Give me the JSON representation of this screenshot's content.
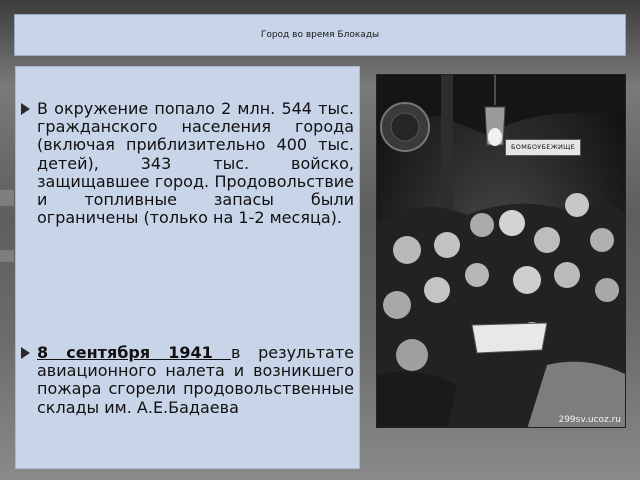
{
  "slide": {
    "title": "Город  во время Блокады",
    "bullets": [
      {
        "text": "В окружение попало 2 млн. 544 тыс. гражданского населения города (включая приблизительно 400 тыс. детей), 343 тыс. войско, защищавшее город. Продовольствие и топливные запасы были ограничены (только на 1-2 месяца)."
      },
      {
        "date": "8 сентября 1941 ",
        "text": "в результате авиационного налета и возникшего пожара сгорели продовольственные склады им. А.Е.Бадаева"
      }
    ]
  },
  "photo": {
    "sign_text": "БОМБОУБЕЖИЩЕ",
    "watermark": "299sv.ucoz.ru"
  }
}
